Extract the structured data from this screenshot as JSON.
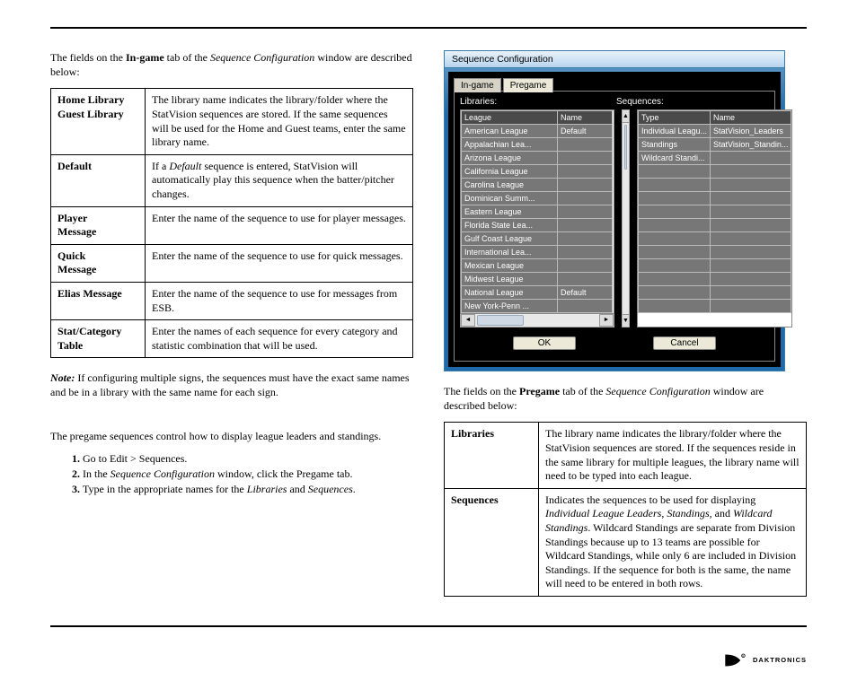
{
  "intro_left": {
    "prefix": "The fields on the ",
    "bold": "In-game",
    "mid": " tab of the ",
    "italic": "Sequence Configuration",
    "suffix": " window are described below:"
  },
  "table_left": [
    {
      "term_lines": [
        "Home Library",
        "Guest Library"
      ],
      "desc": "The library name indicates the library/folder where the StatVision sequences are stored. If the same sequences will be used for the Home and Guest teams, enter the same library name."
    },
    {
      "term_lines": [
        "Default"
      ],
      "desc_parts": [
        {
          "t": "If a "
        },
        {
          "i": "Default"
        },
        {
          "t": " sequence is entered, StatVision will automatically play this sequence when the batter/pitcher changes."
        }
      ]
    },
    {
      "term_lines": [
        "Player",
        "Message"
      ],
      "desc": "Enter the name of the sequence to use for player messages."
    },
    {
      "term_lines": [
        "Quick",
        "Message"
      ],
      "desc": "Enter the name of the sequence to use for quick messages."
    },
    {
      "term_lines": [
        "Elias Message"
      ],
      "desc": "Enter the name of the sequence to use for messages from ESB."
    },
    {
      "term_lines": [
        "Stat/Category",
        "Table"
      ],
      "desc": "Enter the names of each sequence for every category and statistic combination that will be used."
    }
  ],
  "note": {
    "label": "Note:",
    "text": " If configuring multiple signs, the sequences must have the exact same names and be in a library with the same name for each sign."
  },
  "pregame_intro": "The pregame sequences control how to display league leaders and standings.",
  "steps": [
    {
      "parts": [
        {
          "t": "Go to "
        },
        {
          "b": "Edit > Sequences"
        },
        {
          "t": "."
        }
      ]
    },
    {
      "parts": [
        {
          "t": "In the "
        },
        {
          "i": "Sequence Configuration"
        },
        {
          "t": " window, click the "
        },
        {
          "b": "Pregame"
        },
        {
          "t": " tab."
        }
      ]
    },
    {
      "parts": [
        {
          "t": "Type in the appropriate names for the "
        },
        {
          "i": "Libraries"
        },
        {
          "t": " and "
        },
        {
          "i": "Sequences"
        },
        {
          "t": "."
        }
      ]
    }
  ],
  "window": {
    "title": "Sequence Configuration",
    "tabs": [
      "In-game",
      "Pregame"
    ],
    "active_tab": 1,
    "labels": {
      "libraries": "Libraries:",
      "sequences": "Sequences:"
    },
    "left_headers": [
      "League",
      "Name"
    ],
    "left_rows": [
      [
        "American League",
        "Default"
      ],
      [
        "Appalachian Lea...",
        ""
      ],
      [
        "Arizona League",
        ""
      ],
      [
        "California League",
        ""
      ],
      [
        "Carolina League",
        ""
      ],
      [
        "Dominican Summ...",
        ""
      ],
      [
        "Eastern League",
        ""
      ],
      [
        "Florida State Lea...",
        ""
      ],
      [
        "Gulf Coast League",
        ""
      ],
      [
        "International Lea...",
        ""
      ],
      [
        "Mexican League",
        ""
      ],
      [
        "Midwest League",
        ""
      ],
      [
        "National League",
        "Default"
      ],
      [
        "New York-Penn ...",
        ""
      ]
    ],
    "right_headers": [
      "Type",
      "Name"
    ],
    "right_rows": [
      [
        "Individual Leagu...",
        "StatVision_Leaders"
      ],
      [
        "Standings",
        "StatVision_Standin..."
      ],
      [
        "Wildcard Standi...",
        ""
      ]
    ],
    "right_blank_rows": 11,
    "buttons": {
      "ok": "OK",
      "cancel": "Cancel"
    }
  },
  "intro_right": {
    "prefix": "The fields on the ",
    "bold": "Pregame",
    "mid": " tab of the ",
    "italic": "Sequence Configuration",
    "suffix": " window are described below:"
  },
  "table_right": [
    {
      "term": "Libraries",
      "desc": "The library name indicates the library/folder where the StatVision sequences are stored. If the sequences reside in the same library for multiple leagues, the library name will need to be typed into each league."
    },
    {
      "term": "Sequences",
      "desc_parts": [
        {
          "t": "Indicates the sequences to be used for displaying "
        },
        {
          "i": "Individual League Leaders"
        },
        {
          "t": ", "
        },
        {
          "i": "Standings"
        },
        {
          "t": ", and "
        },
        {
          "i": "Wildcard Standings"
        },
        {
          "t": ". Wildcard Standings are separate from Division Standings because up to 13 teams are possible for Wildcard Standings, while only 6 are included in Division Standings.  If the sequence for both is the same, the name will need to be entered in both rows."
        }
      ]
    }
  ],
  "footer_brand": "DAKTRONICS"
}
